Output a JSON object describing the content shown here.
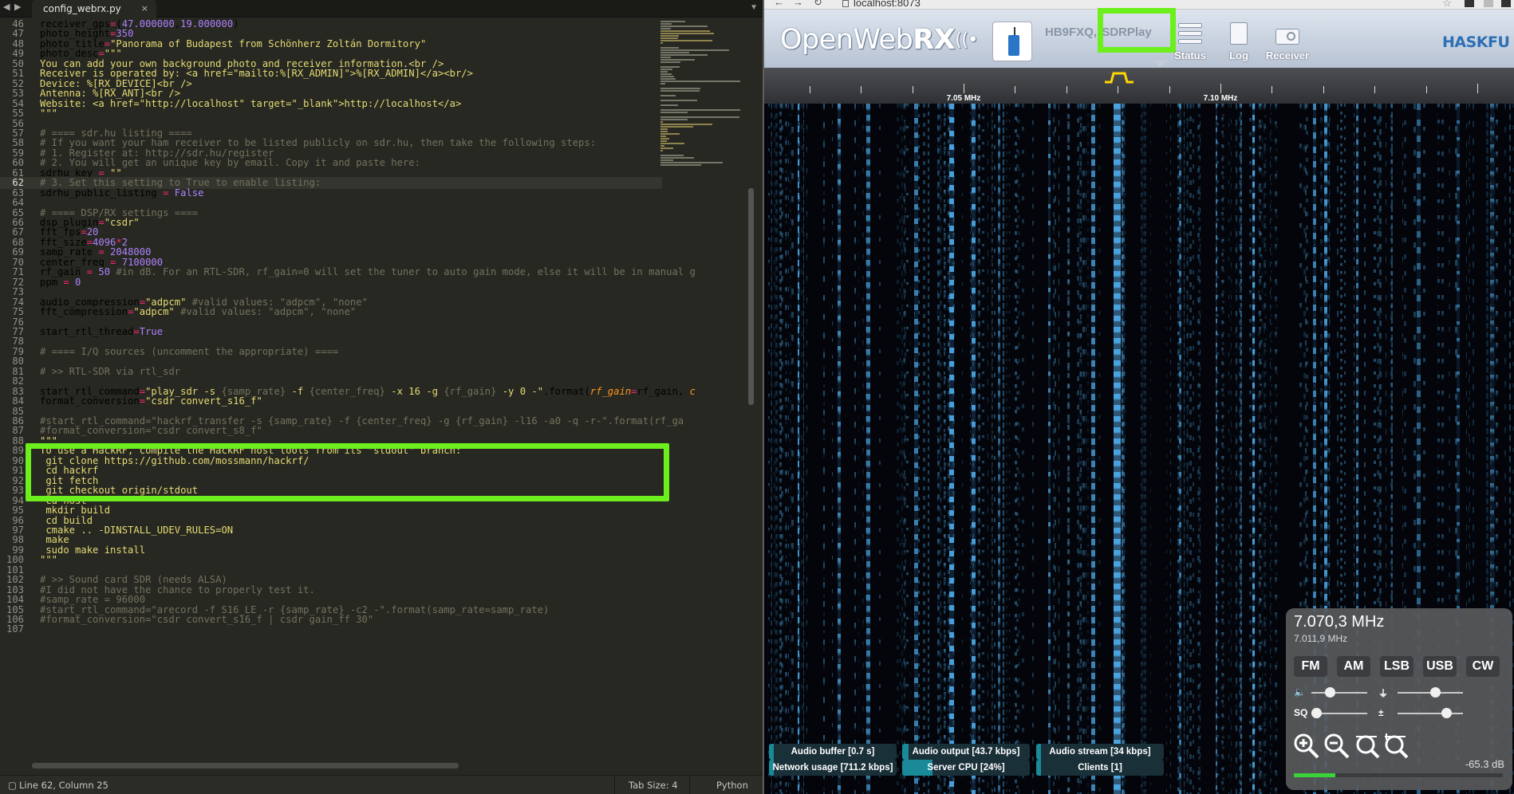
{
  "editor": {
    "tab_title": "config_webrx.py",
    "tab_close": "×",
    "nav_back": "◀",
    "nav_fwd": "▶",
    "tab_menu": "▼",
    "current_line": 62,
    "lines": [
      {
        "n": 46,
        "segs": [
          [
            "tx",
            "receiver_gps"
          ],
          [
            "op",
            "="
          ],
          [
            "tx",
            "("
          ],
          [
            "nm",
            "47.000000"
          ],
          [
            "tx",
            ","
          ],
          [
            "nm",
            "19.000000"
          ],
          [
            "tx",
            ")"
          ]
        ]
      },
      {
        "n": 47,
        "segs": [
          [
            "tx",
            "photo_height"
          ],
          [
            "op",
            "="
          ],
          [
            "nm",
            "350"
          ]
        ]
      },
      {
        "n": 48,
        "segs": [
          [
            "tx",
            "photo_title"
          ],
          [
            "op",
            "="
          ],
          [
            "st",
            "\"Panorama of Budapest from Schönherz Zoltán Dormitory\""
          ]
        ]
      },
      {
        "n": 49,
        "segs": [
          [
            "tx",
            "photo_desc"
          ],
          [
            "op",
            "="
          ],
          [
            "st",
            "\"\"\""
          ]
        ]
      },
      {
        "n": 50,
        "segs": [
          [
            "st",
            "You can add your own background photo and receiver information.<br />"
          ]
        ]
      },
      {
        "n": 51,
        "segs": [
          [
            "st",
            "Receiver is operated by: <a href=\"mailto:%[RX_ADMIN]\">%[RX_ADMIN]</a><br/>"
          ]
        ]
      },
      {
        "n": 52,
        "segs": [
          [
            "st",
            "Device: %[RX_DEVICE]<br />"
          ]
        ]
      },
      {
        "n": 53,
        "segs": [
          [
            "st",
            "Antenna: %[RX_ANT]<br />"
          ]
        ]
      },
      {
        "n": 54,
        "segs": [
          [
            "st",
            "Website: <a href=\"http://localhost\" target=\"_blank\">http://localhost</a>"
          ]
        ]
      },
      {
        "n": 55,
        "segs": [
          [
            "st",
            "\"\"\""
          ]
        ]
      },
      {
        "n": 56,
        "segs": []
      },
      {
        "n": 57,
        "segs": [
          [
            "cm",
            "# ==== sdr.hu listing ===="
          ]
        ]
      },
      {
        "n": 58,
        "segs": [
          [
            "cm",
            "# If you want your ham receiver to be listed publicly on sdr.hu, then take the following steps:"
          ]
        ]
      },
      {
        "n": 59,
        "segs": [
          [
            "cm",
            "# 1. Register at: http://sdr.hu/register"
          ]
        ]
      },
      {
        "n": 60,
        "segs": [
          [
            "cm",
            "# 2. You will get an unique key by email. Copy it and paste here:"
          ]
        ]
      },
      {
        "n": 61,
        "segs": [
          [
            "tx",
            "sdrhu_key "
          ],
          [
            "op",
            "="
          ],
          [
            "st",
            " \"\""
          ]
        ]
      },
      {
        "n": 62,
        "segs": [
          [
            "cm",
            "# 3. Set this setting to True to enable listing:"
          ]
        ]
      },
      {
        "n": 63,
        "segs": [
          [
            "tx",
            "sdrhu_public_listing "
          ],
          [
            "op",
            "="
          ],
          [
            "bi",
            " False"
          ]
        ]
      },
      {
        "n": 64,
        "segs": []
      },
      {
        "n": 65,
        "segs": [
          [
            "cm",
            "# ==== DSP/RX settings ===="
          ]
        ]
      },
      {
        "n": 66,
        "segs": [
          [
            "tx",
            "dsp_plugin"
          ],
          [
            "op",
            "="
          ],
          [
            "st",
            "\"csdr\""
          ]
        ]
      },
      {
        "n": 67,
        "segs": [
          [
            "tx",
            "fft_fps"
          ],
          [
            "op",
            "="
          ],
          [
            "nm",
            "20"
          ]
        ]
      },
      {
        "n": 68,
        "segs": [
          [
            "tx",
            "fft_size"
          ],
          [
            "op",
            "="
          ],
          [
            "nm",
            "4096"
          ],
          [
            "op",
            "*"
          ],
          [
            "nm",
            "2"
          ]
        ]
      },
      {
        "n": 69,
        "segs": [
          [
            "tx",
            "samp_rate "
          ],
          [
            "op",
            "="
          ],
          [
            "nm",
            " 2048000"
          ]
        ]
      },
      {
        "n": 70,
        "segs": [
          [
            "tx",
            "center_freq "
          ],
          [
            "op",
            "="
          ],
          [
            "nm",
            " 7100000"
          ]
        ]
      },
      {
        "n": 71,
        "segs": [
          [
            "tx",
            "rf_gain "
          ],
          [
            "op",
            "="
          ],
          [
            "nm",
            " 50"
          ],
          [
            "cm",
            " #in dB. For an RTL-SDR, rf_gain=0 will set the tuner to auto gain mode, else it will be in manual g"
          ]
        ]
      },
      {
        "n": 72,
        "segs": [
          [
            "tx",
            "ppm "
          ],
          [
            "op",
            "="
          ],
          [
            "nm",
            " 0"
          ]
        ]
      },
      {
        "n": 73,
        "segs": []
      },
      {
        "n": 74,
        "segs": [
          [
            "tx",
            "audio_compression"
          ],
          [
            "op",
            "="
          ],
          [
            "st",
            "\"adpcm\""
          ],
          [
            "cm",
            " #valid values: \"adpcm\", \"none\""
          ]
        ]
      },
      {
        "n": 75,
        "segs": [
          [
            "tx",
            "fft_compression"
          ],
          [
            "op",
            "="
          ],
          [
            "st",
            "\"adpcm\""
          ],
          [
            "cm",
            " #valid values: \"adpcm\", \"none\""
          ]
        ]
      },
      {
        "n": 76,
        "segs": []
      },
      {
        "n": 77,
        "segs": [
          [
            "tx",
            "start_rtl_thread"
          ],
          [
            "op",
            "="
          ],
          [
            "bi",
            "True"
          ]
        ]
      },
      {
        "n": 78,
        "segs": []
      },
      {
        "n": 79,
        "segs": [
          [
            "cm",
            "# ==== I/Q sources (uncomment the appropriate) ===="
          ]
        ]
      },
      {
        "n": 80,
        "segs": []
      },
      {
        "n": 81,
        "segs": [
          [
            "cm",
            "# >> RTL-SDR via rtl_sdr"
          ]
        ]
      },
      {
        "n": 82,
        "segs": []
      },
      {
        "n": 83,
        "segs": [
          [
            "tx",
            "start_rtl_command"
          ],
          [
            "op",
            "="
          ],
          [
            "st",
            "\"play_sdr -s "
          ],
          [
            "cm",
            "{samp_rate}"
          ],
          [
            "st",
            " -f "
          ],
          [
            "cm",
            "{center_freq}"
          ],
          [
            "st",
            " -x 16 -g "
          ],
          [
            "cm",
            "{rf_gain}"
          ],
          [
            "st",
            " -y 0 -\""
          ],
          [
            "tx",
            ".format("
          ],
          [
            "pa",
            "rf_gain"
          ],
          [
            "op",
            "="
          ],
          [
            "tx",
            "rf_gain, "
          ],
          [
            "pa",
            "c"
          ]
        ]
      },
      {
        "n": 84,
        "segs": [
          [
            "tx",
            "format_conversion"
          ],
          [
            "op",
            "="
          ],
          [
            "st",
            "\"csdr convert_s16_f\""
          ]
        ]
      },
      {
        "n": 85,
        "segs": []
      },
      {
        "n": 86,
        "segs": [
          [
            "cm",
            "#start_rtl_command=\"hackrf_transfer -s {samp_rate} -f {center_freq} -g {rf_gain} -l16 -a0 -q -r-\".format(rf_ga"
          ]
        ]
      },
      {
        "n": 87,
        "segs": [
          [
            "cm",
            "#format_conversion=\"csdr convert_s8_f\""
          ]
        ]
      },
      {
        "n": 88,
        "segs": [
          [
            "st",
            "\"\"\""
          ]
        ]
      },
      {
        "n": 89,
        "segs": [
          [
            "st",
            "To use a HackRF, compile the HackRF host tools from its \"stdout\" branch:"
          ]
        ]
      },
      {
        "n": 90,
        "segs": [
          [
            "st",
            " git clone https://github.com/mossmann/hackrf/"
          ]
        ]
      },
      {
        "n": 91,
        "segs": [
          [
            "st",
            " cd hackrf"
          ]
        ]
      },
      {
        "n": 92,
        "segs": [
          [
            "st",
            " git fetch"
          ]
        ]
      },
      {
        "n": 93,
        "segs": [
          [
            "st",
            " git checkout origin/stdout"
          ]
        ]
      },
      {
        "n": 94,
        "segs": [
          [
            "st",
            " cd host"
          ]
        ]
      },
      {
        "n": 95,
        "segs": [
          [
            "st",
            " mkdir build"
          ]
        ]
      },
      {
        "n": 96,
        "segs": [
          [
            "st",
            " cd build"
          ]
        ]
      },
      {
        "n": 97,
        "segs": [
          [
            "st",
            " cmake .. -DINSTALL_UDEV_RULES=ON"
          ]
        ]
      },
      {
        "n": 98,
        "segs": [
          [
            "st",
            " make"
          ]
        ]
      },
      {
        "n": 99,
        "segs": [
          [
            "st",
            " sudo make install"
          ]
        ]
      },
      {
        "n": 100,
        "segs": [
          [
            "st",
            "\"\"\""
          ]
        ]
      },
      {
        "n": 101,
        "segs": []
      },
      {
        "n": 102,
        "segs": [
          [
            "cm",
            "# >> Sound card SDR (needs ALSA)"
          ]
        ]
      },
      {
        "n": 103,
        "segs": [
          [
            "cm",
            "#I did not have the chance to properly test it."
          ]
        ]
      },
      {
        "n": 104,
        "segs": [
          [
            "cm",
            "#samp_rate = 96000"
          ]
        ]
      },
      {
        "n": 105,
        "segs": [
          [
            "cm",
            "#start_rtl_command=\"arecord -f S16_LE -r {samp_rate} -c2 -\".format(samp_rate=samp_rate)"
          ]
        ]
      },
      {
        "n": 106,
        "segs": [
          [
            "cm",
            "#format_conversion=\"csdr convert_s16_f | csdr gain_ff 30\""
          ]
        ]
      },
      {
        "n": 107,
        "segs": []
      }
    ],
    "status": {
      "position": "Line 62, Column 25",
      "tab_size": "Tab Size: 4",
      "syntax": "Python"
    },
    "colors": {
      "background": "#272822",
      "highlight_box": "#6cef1c"
    }
  },
  "browser": {
    "url": "localhost:8073",
    "back": "←",
    "forward": "→",
    "reload": "↻",
    "star": "☆"
  },
  "openwebrx": {
    "logo_text": "OpenWeb",
    "logo_rx": "RX",
    "logo_wave": "((•",
    "receiver_callsign": "HB9FXQ,",
    "receiver_device": "SDRPlay",
    "buttons": {
      "status": "Status",
      "log": "Log",
      "receiver": "Receiver"
    },
    "partner_logo": "HASKFU",
    "scale": {
      "labels": [
        "7.05 MHz",
        "7.10 MHz"
      ]
    },
    "panel": {
      "frequency": "7.070,3 MHz",
      "offset_frequency": "7.011,9 MHz",
      "modes": [
        "FM",
        "AM",
        "LSB",
        "USB",
        "CW"
      ],
      "volume_level": 0.3,
      "nr_level": 0.6,
      "squelch_level": 0.0,
      "gain_level": 0.8,
      "squelch_label": "SQ",
      "signal_db": "-65.3 dB",
      "smeter_level": 0.2
    },
    "status_badges": [
      {
        "label": "Audio buffer [0.7 s]",
        "level": 0.04
      },
      {
        "label": "Audio output [43.7 kbps]",
        "level": 0.05
      },
      {
        "label": "Audio stream [34 kbps]",
        "level": 0.04
      },
      {
        "label": "Network usage [711.2 kbps]",
        "level": 0.04
      },
      {
        "label": "Server CPU [24%]",
        "level": 0.24
      },
      {
        "label": "Clients [1]",
        "level": 0.03
      }
    ],
    "colors": {
      "waterfall_signal": "#4aa3df",
      "badge_fill": "#1a8a98",
      "highlight_box": "#6cef1c"
    }
  }
}
